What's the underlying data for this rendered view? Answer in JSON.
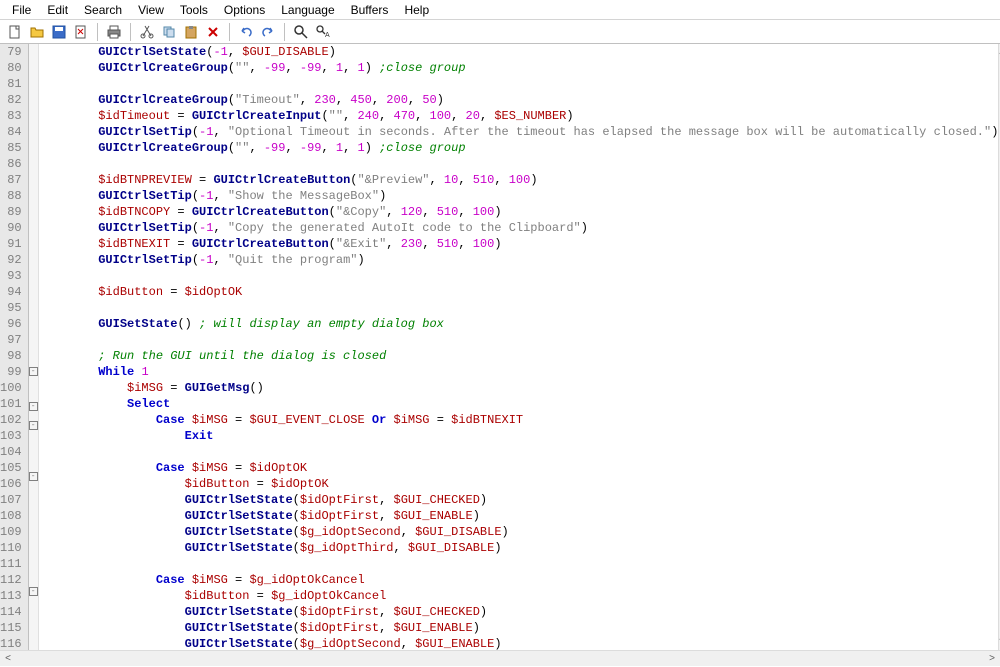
{
  "menu": {
    "file": "File",
    "edit": "Edit",
    "search": "Search",
    "view": "View",
    "tools": "Tools",
    "options": "Options",
    "language": "Language",
    "buffers": "Buffers",
    "help": "Help"
  },
  "lines": {
    "start": 79,
    "end": 116
  },
  "fold_markers": {
    "99": "-",
    "101": "-",
    "102": "-",
    "105": "-",
    "112": "-"
  },
  "code": [
    {
      "n": 79,
      "i": 2,
      "t": [
        [
          "fn",
          "GUICtrlSetState"
        ],
        [
          "",
          "("
        ],
        [
          "num",
          "-1"
        ],
        [
          "",
          ", "
        ],
        [
          "var",
          "$GUI_DISABLE"
        ],
        [
          "",
          ")"
        ]
      ]
    },
    {
      "n": 80,
      "i": 2,
      "t": [
        [
          "fn",
          "GUICtrlCreateGroup"
        ],
        [
          "",
          "("
        ],
        [
          "str",
          "\"\""
        ],
        [
          "",
          ", "
        ],
        [
          "num",
          "-99"
        ],
        [
          "",
          ", "
        ],
        [
          "num",
          "-99"
        ],
        [
          "",
          ", "
        ],
        [
          "num",
          "1"
        ],
        [
          "",
          ", "
        ],
        [
          "num",
          "1"
        ],
        [
          "",
          ") "
        ],
        [
          "com",
          ";close group"
        ]
      ]
    },
    {
      "n": 81,
      "i": 0,
      "t": []
    },
    {
      "n": 82,
      "i": 2,
      "t": [
        [
          "fn",
          "GUICtrlCreateGroup"
        ],
        [
          "",
          "("
        ],
        [
          "str",
          "\"Timeout\""
        ],
        [
          "",
          ", "
        ],
        [
          "num",
          "230"
        ],
        [
          "",
          ", "
        ],
        [
          "num",
          "450"
        ],
        [
          "",
          ", "
        ],
        [
          "num",
          "200"
        ],
        [
          "",
          ", "
        ],
        [
          "num",
          "50"
        ],
        [
          "",
          ")"
        ]
      ]
    },
    {
      "n": 83,
      "i": 2,
      "t": [
        [
          "var",
          "$idTimeout"
        ],
        [
          "",
          " = "
        ],
        [
          "fn",
          "GUICtrlCreateInput"
        ],
        [
          "",
          "("
        ],
        [
          "str",
          "\"\""
        ],
        [
          "",
          ", "
        ],
        [
          "num",
          "240"
        ],
        [
          "",
          ", "
        ],
        [
          "num",
          "470"
        ],
        [
          "",
          ", "
        ],
        [
          "num",
          "100"
        ],
        [
          "",
          ", "
        ],
        [
          "num",
          "20"
        ],
        [
          "",
          ", "
        ],
        [
          "var",
          "$ES_NUMBER"
        ],
        [
          "",
          ")"
        ]
      ]
    },
    {
      "n": 84,
      "i": 2,
      "t": [
        [
          "fn",
          "GUICtrlSetTip"
        ],
        [
          "",
          "("
        ],
        [
          "num",
          "-1"
        ],
        [
          "",
          ", "
        ],
        [
          "str",
          "\"Optional Timeout in seconds. After the timeout has elapsed the message box will be automatically closed.\""
        ],
        [
          "",
          ")"
        ]
      ]
    },
    {
      "n": 85,
      "i": 2,
      "t": [
        [
          "fn",
          "GUICtrlCreateGroup"
        ],
        [
          "",
          "("
        ],
        [
          "str",
          "\"\""
        ],
        [
          "",
          ", "
        ],
        [
          "num",
          "-99"
        ],
        [
          "",
          ", "
        ],
        [
          "num",
          "-99"
        ],
        [
          "",
          ", "
        ],
        [
          "num",
          "1"
        ],
        [
          "",
          ", "
        ],
        [
          "num",
          "1"
        ],
        [
          "",
          ") "
        ],
        [
          "com",
          ";close group"
        ]
      ]
    },
    {
      "n": 86,
      "i": 0,
      "t": []
    },
    {
      "n": 87,
      "i": 2,
      "t": [
        [
          "var",
          "$idBTNPREVIEW"
        ],
        [
          "",
          " = "
        ],
        [
          "fn",
          "GUICtrlCreateButton"
        ],
        [
          "",
          "("
        ],
        [
          "str",
          "\"&Preview\""
        ],
        [
          "",
          ", "
        ],
        [
          "num",
          "10"
        ],
        [
          "",
          ", "
        ],
        [
          "num",
          "510"
        ],
        [
          "",
          ", "
        ],
        [
          "num",
          "100"
        ],
        [
          "",
          ")"
        ]
      ]
    },
    {
      "n": 88,
      "i": 2,
      "t": [
        [
          "fn",
          "GUICtrlSetTip"
        ],
        [
          "",
          "("
        ],
        [
          "num",
          "-1"
        ],
        [
          "",
          ", "
        ],
        [
          "str",
          "\"Show the MessageBox\""
        ],
        [
          "",
          ")"
        ]
      ]
    },
    {
      "n": 89,
      "i": 2,
      "t": [
        [
          "var",
          "$idBTNCOPY"
        ],
        [
          "",
          " = "
        ],
        [
          "fn",
          "GUICtrlCreateButton"
        ],
        [
          "",
          "("
        ],
        [
          "str",
          "\"&Copy\""
        ],
        [
          "",
          ", "
        ],
        [
          "num",
          "120"
        ],
        [
          "",
          ", "
        ],
        [
          "num",
          "510"
        ],
        [
          "",
          ", "
        ],
        [
          "num",
          "100"
        ],
        [
          "",
          ")"
        ]
      ]
    },
    {
      "n": 90,
      "i": 2,
      "t": [
        [
          "fn",
          "GUICtrlSetTip"
        ],
        [
          "",
          "("
        ],
        [
          "num",
          "-1"
        ],
        [
          "",
          ", "
        ],
        [
          "str",
          "\"Copy the generated AutoIt code to the Clipboard\""
        ],
        [
          "",
          ")"
        ]
      ]
    },
    {
      "n": 91,
      "i": 2,
      "t": [
        [
          "var",
          "$idBTNEXIT"
        ],
        [
          "",
          " = "
        ],
        [
          "fn",
          "GUICtrlCreateButton"
        ],
        [
          "",
          "("
        ],
        [
          "str",
          "\"&Exit\""
        ],
        [
          "",
          ", "
        ],
        [
          "num",
          "230"
        ],
        [
          "",
          ", "
        ],
        [
          "num",
          "510"
        ],
        [
          "",
          ", "
        ],
        [
          "num",
          "100"
        ],
        [
          "",
          ")"
        ]
      ]
    },
    {
      "n": 92,
      "i": 2,
      "t": [
        [
          "fn",
          "GUICtrlSetTip"
        ],
        [
          "",
          "("
        ],
        [
          "num",
          "-1"
        ],
        [
          "",
          ", "
        ],
        [
          "str",
          "\"Quit the program\""
        ],
        [
          "",
          ")"
        ]
      ]
    },
    {
      "n": 93,
      "i": 0,
      "t": []
    },
    {
      "n": 94,
      "i": 2,
      "t": [
        [
          "var",
          "$idButton"
        ],
        [
          "",
          " = "
        ],
        [
          "var",
          "$idOptOK"
        ]
      ]
    },
    {
      "n": 95,
      "i": 0,
      "t": []
    },
    {
      "n": 96,
      "i": 2,
      "t": [
        [
          "fn",
          "GUISetState"
        ],
        [
          "",
          "() "
        ],
        [
          "com",
          "; will display an empty dialog box"
        ]
      ]
    },
    {
      "n": 97,
      "i": 0,
      "t": []
    },
    {
      "n": 98,
      "i": 2,
      "t": [
        [
          "com",
          "; Run the GUI until the dialog is closed"
        ]
      ]
    },
    {
      "n": 99,
      "i": 2,
      "t": [
        [
          "kw",
          "While"
        ],
        [
          "",
          " "
        ],
        [
          "num",
          "1"
        ]
      ]
    },
    {
      "n": 100,
      "i": 3,
      "t": [
        [
          "var",
          "$iMSG"
        ],
        [
          "",
          " = "
        ],
        [
          "fn",
          "GUIGetMsg"
        ],
        [
          "",
          "()"
        ]
      ]
    },
    {
      "n": 101,
      "i": 3,
      "t": [
        [
          "kw",
          "Select"
        ]
      ]
    },
    {
      "n": 102,
      "i": 4,
      "t": [
        [
          "kw",
          "Case"
        ],
        [
          "",
          " "
        ],
        [
          "var",
          "$iMSG"
        ],
        [
          "",
          " = "
        ],
        [
          "var",
          "$GUI_EVENT_CLOSE"
        ],
        [
          "",
          " "
        ],
        [
          "kw",
          "Or"
        ],
        [
          "",
          " "
        ],
        [
          "var",
          "$iMSG"
        ],
        [
          "",
          " = "
        ],
        [
          "var",
          "$idBTNEXIT"
        ]
      ]
    },
    {
      "n": 103,
      "i": 5,
      "t": [
        [
          "kw",
          "Exit"
        ]
      ]
    },
    {
      "n": 104,
      "i": 0,
      "t": []
    },
    {
      "n": 105,
      "i": 4,
      "t": [
        [
          "kw",
          "Case"
        ],
        [
          "",
          " "
        ],
        [
          "var",
          "$iMSG"
        ],
        [
          "",
          " = "
        ],
        [
          "var",
          "$idOptOK"
        ]
      ]
    },
    {
      "n": 106,
      "i": 5,
      "t": [
        [
          "var",
          "$idButton"
        ],
        [
          "",
          " = "
        ],
        [
          "var",
          "$idOptOK"
        ]
      ]
    },
    {
      "n": 107,
      "i": 5,
      "t": [
        [
          "fn",
          "GUICtrlSetState"
        ],
        [
          "",
          "("
        ],
        [
          "var",
          "$idOptFirst"
        ],
        [
          "",
          ", "
        ],
        [
          "var",
          "$GUI_CHECKED"
        ],
        [
          "",
          ")"
        ]
      ]
    },
    {
      "n": 108,
      "i": 5,
      "t": [
        [
          "fn",
          "GUICtrlSetState"
        ],
        [
          "",
          "("
        ],
        [
          "var",
          "$idOptFirst"
        ],
        [
          "",
          ", "
        ],
        [
          "var",
          "$GUI_ENABLE"
        ],
        [
          "",
          ")"
        ]
      ]
    },
    {
      "n": 109,
      "i": 5,
      "t": [
        [
          "fn",
          "GUICtrlSetState"
        ],
        [
          "",
          "("
        ],
        [
          "var",
          "$g_idOptSecond"
        ],
        [
          "",
          ", "
        ],
        [
          "var",
          "$GUI_DISABLE"
        ],
        [
          "",
          ")"
        ]
      ]
    },
    {
      "n": 110,
      "i": 5,
      "t": [
        [
          "fn",
          "GUICtrlSetState"
        ],
        [
          "",
          "("
        ],
        [
          "var",
          "$g_idOptThird"
        ],
        [
          "",
          ", "
        ],
        [
          "var",
          "$GUI_DISABLE"
        ],
        [
          "",
          ")"
        ]
      ]
    },
    {
      "n": 111,
      "i": 0,
      "t": []
    },
    {
      "n": 112,
      "i": 4,
      "t": [
        [
          "kw",
          "Case"
        ],
        [
          "",
          " "
        ],
        [
          "var",
          "$iMSG"
        ],
        [
          "",
          " = "
        ],
        [
          "var",
          "$g_idOptOkCancel"
        ]
      ]
    },
    {
      "n": 113,
      "i": 5,
      "t": [
        [
          "var",
          "$idButton"
        ],
        [
          "",
          " = "
        ],
        [
          "var",
          "$g_idOptOkCancel"
        ]
      ]
    },
    {
      "n": 114,
      "i": 5,
      "t": [
        [
          "fn",
          "GUICtrlSetState"
        ],
        [
          "",
          "("
        ],
        [
          "var",
          "$idOptFirst"
        ],
        [
          "",
          ", "
        ],
        [
          "var",
          "$GUI_CHECKED"
        ],
        [
          "",
          ")"
        ]
      ]
    },
    {
      "n": 115,
      "i": 5,
      "t": [
        [
          "fn",
          "GUICtrlSetState"
        ],
        [
          "",
          "("
        ],
        [
          "var",
          "$idOptFirst"
        ],
        [
          "",
          ", "
        ],
        [
          "var",
          "$GUI_ENABLE"
        ],
        [
          "",
          ")"
        ]
      ]
    },
    {
      "n": 116,
      "i": 5,
      "t": [
        [
          "fn",
          "GUICtrlSetState"
        ],
        [
          "",
          "("
        ],
        [
          "var",
          "$g_idOptSecond"
        ],
        [
          "",
          ", "
        ],
        [
          "var",
          "$GUI_ENABLE"
        ],
        [
          "",
          ")"
        ]
      ]
    }
  ]
}
